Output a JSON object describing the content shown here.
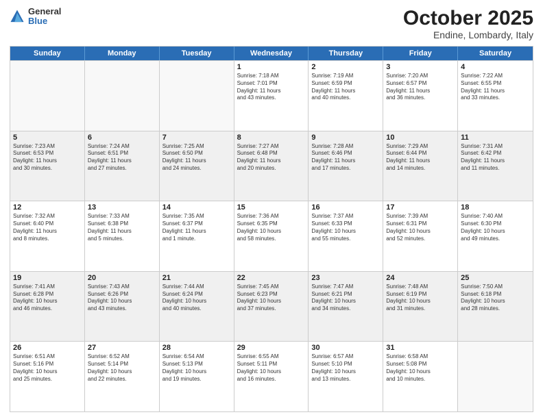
{
  "logo": {
    "general": "General",
    "blue": "Blue"
  },
  "title": "October 2025",
  "subtitle": "Endine, Lombardy, Italy",
  "headers": [
    "Sunday",
    "Monday",
    "Tuesday",
    "Wednesday",
    "Thursday",
    "Friday",
    "Saturday"
  ],
  "weeks": [
    [
      {
        "day": "",
        "info": ""
      },
      {
        "day": "",
        "info": ""
      },
      {
        "day": "",
        "info": ""
      },
      {
        "day": "1",
        "info": "Sunrise: 7:18 AM\nSunset: 7:01 PM\nDaylight: 11 hours\nand 43 minutes."
      },
      {
        "day": "2",
        "info": "Sunrise: 7:19 AM\nSunset: 6:59 PM\nDaylight: 11 hours\nand 40 minutes."
      },
      {
        "day": "3",
        "info": "Sunrise: 7:20 AM\nSunset: 6:57 PM\nDaylight: 11 hours\nand 36 minutes."
      },
      {
        "day": "4",
        "info": "Sunrise: 7:22 AM\nSunset: 6:55 PM\nDaylight: 11 hours\nand 33 minutes."
      }
    ],
    [
      {
        "day": "5",
        "info": "Sunrise: 7:23 AM\nSunset: 6:53 PM\nDaylight: 11 hours\nand 30 minutes."
      },
      {
        "day": "6",
        "info": "Sunrise: 7:24 AM\nSunset: 6:51 PM\nDaylight: 11 hours\nand 27 minutes."
      },
      {
        "day": "7",
        "info": "Sunrise: 7:25 AM\nSunset: 6:50 PM\nDaylight: 11 hours\nand 24 minutes."
      },
      {
        "day": "8",
        "info": "Sunrise: 7:27 AM\nSunset: 6:48 PM\nDaylight: 11 hours\nand 20 minutes."
      },
      {
        "day": "9",
        "info": "Sunrise: 7:28 AM\nSunset: 6:46 PM\nDaylight: 11 hours\nand 17 minutes."
      },
      {
        "day": "10",
        "info": "Sunrise: 7:29 AM\nSunset: 6:44 PM\nDaylight: 11 hours\nand 14 minutes."
      },
      {
        "day": "11",
        "info": "Sunrise: 7:31 AM\nSunset: 6:42 PM\nDaylight: 11 hours\nand 11 minutes."
      }
    ],
    [
      {
        "day": "12",
        "info": "Sunrise: 7:32 AM\nSunset: 6:40 PM\nDaylight: 11 hours\nand 8 minutes."
      },
      {
        "day": "13",
        "info": "Sunrise: 7:33 AM\nSunset: 6:38 PM\nDaylight: 11 hours\nand 5 minutes."
      },
      {
        "day": "14",
        "info": "Sunrise: 7:35 AM\nSunset: 6:37 PM\nDaylight: 11 hours\nand 1 minute."
      },
      {
        "day": "15",
        "info": "Sunrise: 7:36 AM\nSunset: 6:35 PM\nDaylight: 10 hours\nand 58 minutes."
      },
      {
        "day": "16",
        "info": "Sunrise: 7:37 AM\nSunset: 6:33 PM\nDaylight: 10 hours\nand 55 minutes."
      },
      {
        "day": "17",
        "info": "Sunrise: 7:39 AM\nSunset: 6:31 PM\nDaylight: 10 hours\nand 52 minutes."
      },
      {
        "day": "18",
        "info": "Sunrise: 7:40 AM\nSunset: 6:30 PM\nDaylight: 10 hours\nand 49 minutes."
      }
    ],
    [
      {
        "day": "19",
        "info": "Sunrise: 7:41 AM\nSunset: 6:28 PM\nDaylight: 10 hours\nand 46 minutes."
      },
      {
        "day": "20",
        "info": "Sunrise: 7:43 AM\nSunset: 6:26 PM\nDaylight: 10 hours\nand 43 minutes."
      },
      {
        "day": "21",
        "info": "Sunrise: 7:44 AM\nSunset: 6:24 PM\nDaylight: 10 hours\nand 40 minutes."
      },
      {
        "day": "22",
        "info": "Sunrise: 7:45 AM\nSunset: 6:23 PM\nDaylight: 10 hours\nand 37 minutes."
      },
      {
        "day": "23",
        "info": "Sunrise: 7:47 AM\nSunset: 6:21 PM\nDaylight: 10 hours\nand 34 minutes."
      },
      {
        "day": "24",
        "info": "Sunrise: 7:48 AM\nSunset: 6:19 PM\nDaylight: 10 hours\nand 31 minutes."
      },
      {
        "day": "25",
        "info": "Sunrise: 7:50 AM\nSunset: 6:18 PM\nDaylight: 10 hours\nand 28 minutes."
      }
    ],
    [
      {
        "day": "26",
        "info": "Sunrise: 6:51 AM\nSunset: 5:16 PM\nDaylight: 10 hours\nand 25 minutes."
      },
      {
        "day": "27",
        "info": "Sunrise: 6:52 AM\nSunset: 5:14 PM\nDaylight: 10 hours\nand 22 minutes."
      },
      {
        "day": "28",
        "info": "Sunrise: 6:54 AM\nSunset: 5:13 PM\nDaylight: 10 hours\nand 19 minutes."
      },
      {
        "day": "29",
        "info": "Sunrise: 6:55 AM\nSunset: 5:11 PM\nDaylight: 10 hours\nand 16 minutes."
      },
      {
        "day": "30",
        "info": "Sunrise: 6:57 AM\nSunset: 5:10 PM\nDaylight: 10 hours\nand 13 minutes."
      },
      {
        "day": "31",
        "info": "Sunrise: 6:58 AM\nSunset: 5:08 PM\nDaylight: 10 hours\nand 10 minutes."
      },
      {
        "day": "",
        "info": ""
      }
    ]
  ]
}
